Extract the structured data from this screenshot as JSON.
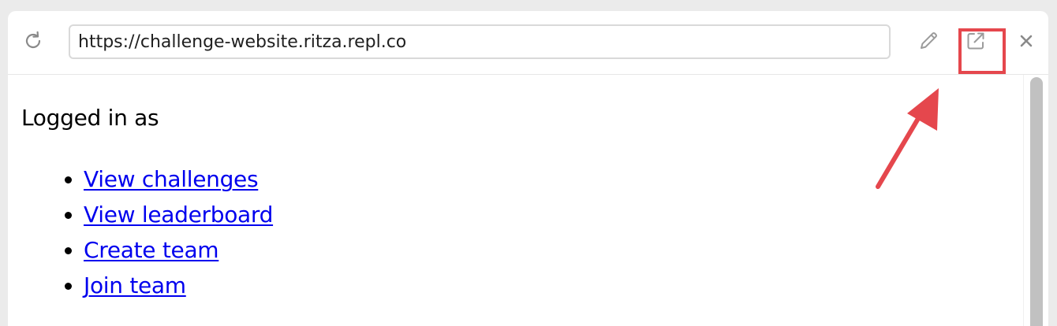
{
  "toolbar": {
    "url_value": "https://challenge-website.ritza.repl.co",
    "reload_icon": "reload-icon",
    "edit_icon": "pencil-icon",
    "open_new_tab_icon": "external-link-icon",
    "close_icon": "close-icon"
  },
  "page": {
    "heading": "Logged in as",
    "links": [
      {
        "label": "View challenges"
      },
      {
        "label": "View leaderboard"
      },
      {
        "label": "Create team"
      },
      {
        "label": "Join team"
      }
    ]
  },
  "annotation": {
    "color": "#e5474d"
  },
  "colors": {
    "link": "#0000ee",
    "icon": "#9b9b9b"
  }
}
